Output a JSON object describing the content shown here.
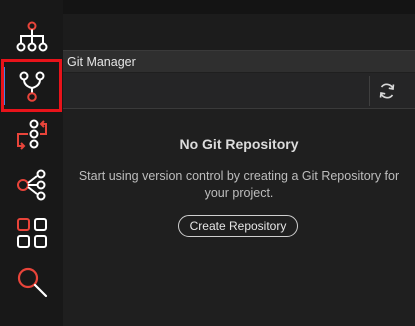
{
  "activity_bar": {
    "items": [
      {
        "name": "hierarchy",
        "icon": "hierarchy-icon",
        "active": false
      },
      {
        "name": "git",
        "icon": "git-branch-icon",
        "active": true
      },
      {
        "name": "flow",
        "icon": "flow-icon",
        "active": false
      },
      {
        "name": "share",
        "icon": "share-icon",
        "active": false
      },
      {
        "name": "grid",
        "icon": "grid-icon",
        "active": false
      },
      {
        "name": "search",
        "icon": "search-icon",
        "active": false
      }
    ]
  },
  "panel": {
    "title": "Git Manager",
    "refresh_icon": "refresh-icon"
  },
  "empty_state": {
    "title": "No Git Repository",
    "description_line1": "Start using version control by creating a Git Repository for",
    "description_line2": "your project.",
    "button_label": "Create Repository"
  },
  "colors": {
    "icon_accent": "#e8443a",
    "active_indicator": "#3f86e8",
    "highlight": "#e8131a"
  }
}
